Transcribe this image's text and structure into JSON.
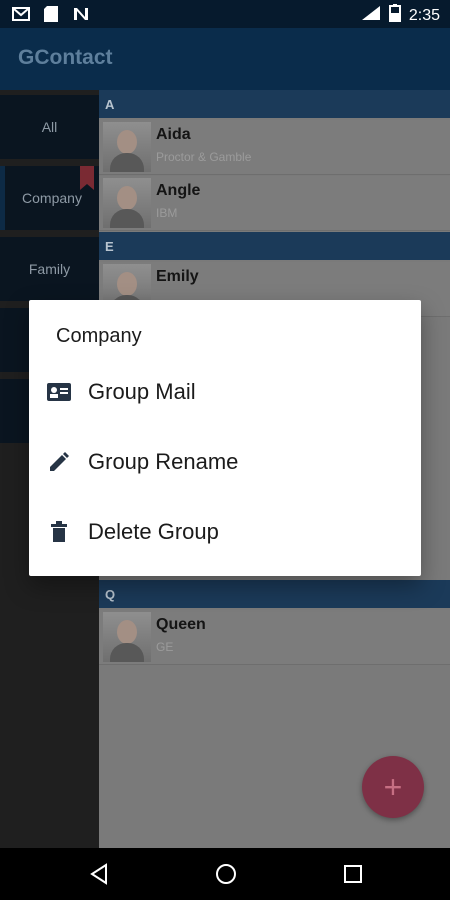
{
  "status": {
    "time": "2:35",
    "left_icons": [
      "gmail-icon",
      "sd-card-icon",
      "n-icon"
    ],
    "right_icons": [
      "signal-icon",
      "battery-icon"
    ],
    "battery_level": 0.55
  },
  "app": {
    "title": "GContact"
  },
  "sidebar": {
    "items": [
      {
        "label": "All",
        "selected": false
      },
      {
        "label": "Company",
        "selected": true
      },
      {
        "label": "Family",
        "selected": false
      }
    ]
  },
  "contacts": {
    "sections": [
      {
        "letter": "A"
      },
      {
        "letter": "E"
      },
      {
        "letter": "Q"
      }
    ],
    "rows": [
      {
        "name": "Aida",
        "company": "Proctor & Gamble"
      },
      {
        "name": "Angle",
        "company": "IBM"
      },
      {
        "name": "Emily",
        "company": ""
      },
      {
        "name": "Queen",
        "company": "GE"
      }
    ]
  },
  "dialog": {
    "title": "Company",
    "items": [
      {
        "label": "Group Mail",
        "icon": "contact-card-icon"
      },
      {
        "label": "Group Rename",
        "icon": "pencil-icon"
      },
      {
        "label": "Delete Group",
        "icon": "trash-icon"
      }
    ]
  },
  "fab": {
    "label": "+"
  },
  "colors": {
    "accent": "#e91e63",
    "primary": "#1565c0",
    "dark_primary": "#0d47a1"
  }
}
